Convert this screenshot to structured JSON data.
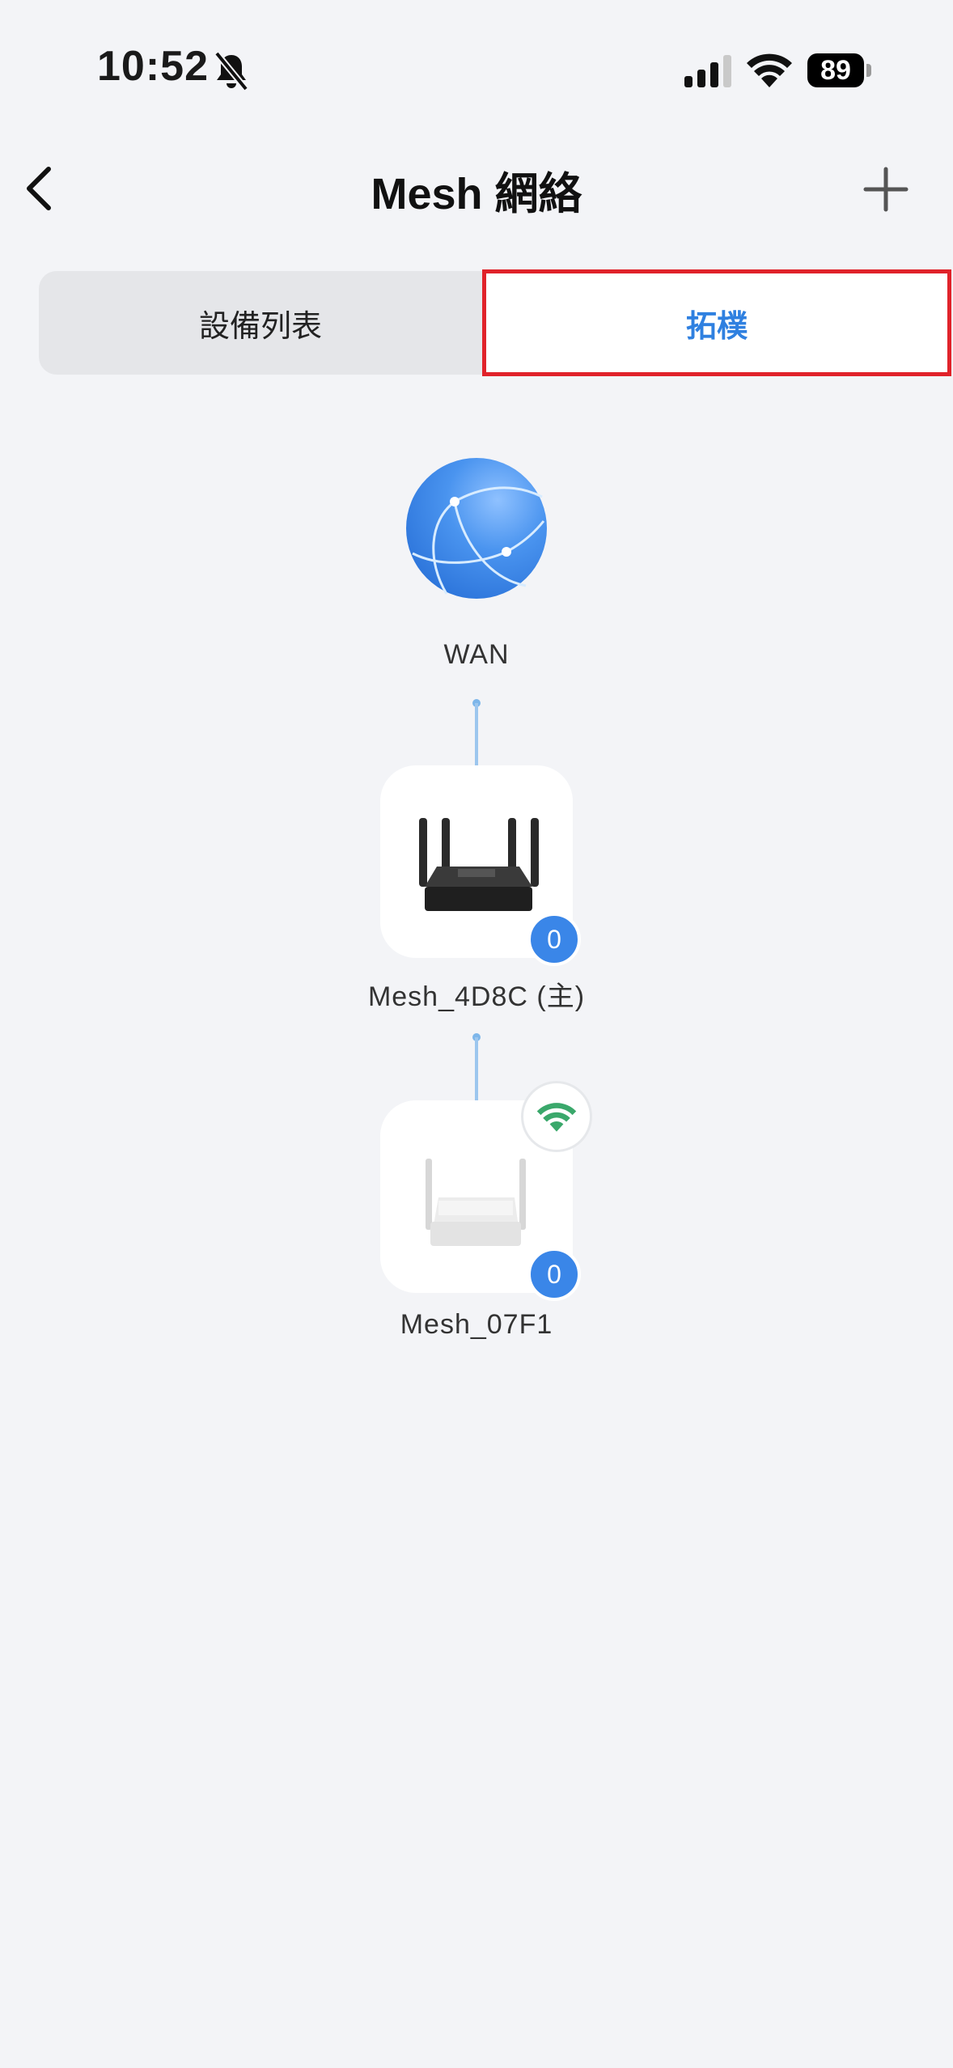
{
  "status_bar": {
    "time": "10:52",
    "battery": "89",
    "icons": [
      "bell-slash-icon",
      "cellular-signal-icon",
      "wifi-icon",
      "battery-icon"
    ]
  },
  "header": {
    "title": "Mesh 網絡",
    "back_icon": "chevron-left-icon",
    "add_icon": "plus-icon"
  },
  "tabs": [
    {
      "label": "設備列表",
      "selected": false
    },
    {
      "label": "拓樸",
      "selected": true
    }
  ],
  "topology": {
    "wan": {
      "label": "WAN",
      "icon": "globe-icon"
    },
    "nodes": [
      {
        "label": "Mesh_4D8C (主)",
        "client_count": "0",
        "icon": "black-router-icon"
      },
      {
        "label": "Mesh_07F1",
        "client_count": "0",
        "icon": "white-router-icon",
        "connection_icon": "wifi-icon"
      }
    ]
  },
  "colors": {
    "accent": "#2f80e0",
    "badge": "#3a86e8",
    "wifi_green": "#3aa86b",
    "highlight_border": "#e0222a",
    "background": "#f3f4f7"
  }
}
